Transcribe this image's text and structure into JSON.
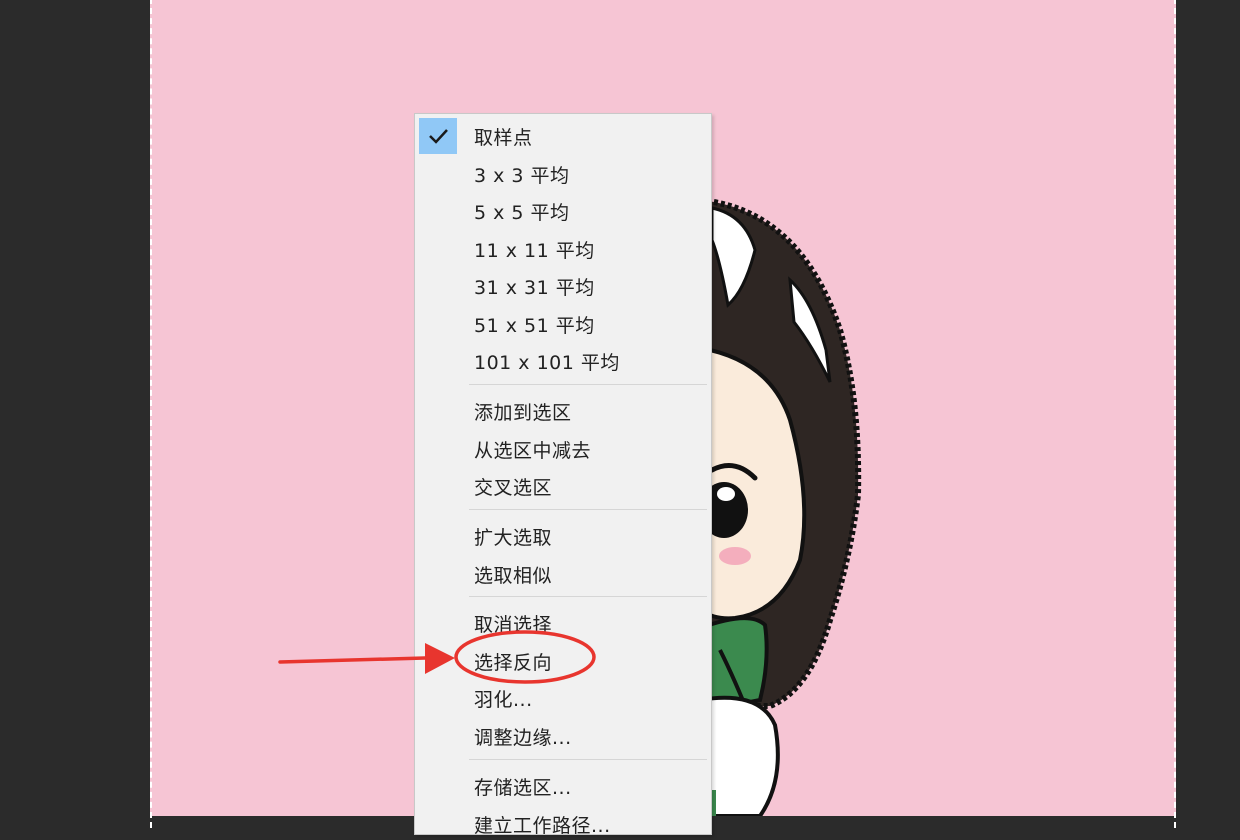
{
  "menu": {
    "items": [
      {
        "label": "取样点",
        "checked": true
      },
      {
        "label": "3 x 3 平均"
      },
      {
        "label": "5 x 5 平均"
      },
      {
        "label": "11 x 11 平均"
      },
      {
        "label": "31 x 31 平均"
      },
      {
        "label": "51 x 51 平均"
      },
      {
        "label": "101 x 101 平均"
      },
      {
        "label": "添加到选区"
      },
      {
        "label": "从选区中减去"
      },
      {
        "label": "交叉选区"
      },
      {
        "label": "扩大选取"
      },
      {
        "label": "选取相似"
      },
      {
        "label": "取消选择"
      },
      {
        "label": "选择反向",
        "highlighted": true
      },
      {
        "label": "羽化..."
      },
      {
        "label": "调整边缘..."
      },
      {
        "label": "存储选区..."
      },
      {
        "label": "建立工作路径..."
      }
    ]
  },
  "colors": {
    "canvas": "#f6c5d4",
    "workspace": "#2b2b2b",
    "menu_bg": "#f1f1f1",
    "check_bg": "#90c8f6",
    "annotation": "#e8352e"
  },
  "icons": {
    "check": "checkmark-icon"
  }
}
